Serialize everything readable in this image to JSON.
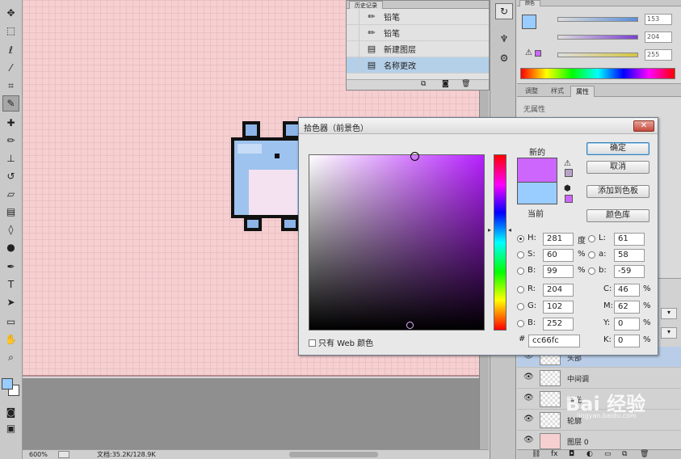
{
  "toolbox": {
    "tools": [
      {
        "name": "move-tool-icon",
        "glyph": "✥"
      },
      {
        "name": "marquee-tool-icon",
        "glyph": "⬚"
      },
      {
        "name": "lasso-tool-icon",
        "glyph": "ℓ"
      },
      {
        "name": "magic-wand-tool-icon",
        "glyph": "⁄"
      },
      {
        "name": "crop-tool-icon",
        "glyph": "⌗"
      },
      {
        "name": "eyedropper-tool-icon",
        "glyph": "✎"
      },
      {
        "name": "healing-brush-tool-icon",
        "glyph": "✚"
      },
      {
        "name": "brush-tool-icon",
        "glyph": "✏"
      },
      {
        "name": "clone-stamp-tool-icon",
        "glyph": "⊥"
      },
      {
        "name": "history-brush-tool-icon",
        "glyph": "↺"
      },
      {
        "name": "eraser-tool-icon",
        "glyph": "▱"
      },
      {
        "name": "gradient-tool-icon",
        "glyph": "▤"
      },
      {
        "name": "blur-tool-icon",
        "glyph": "◊"
      },
      {
        "name": "dodge-tool-icon",
        "glyph": "●"
      },
      {
        "name": "pen-tool-icon",
        "glyph": "✒"
      },
      {
        "name": "type-tool-icon",
        "glyph": "T"
      },
      {
        "name": "path-selection-tool-icon",
        "glyph": "➤"
      },
      {
        "name": "shape-tool-icon",
        "glyph": "▭"
      },
      {
        "name": "hand-tool-icon",
        "glyph": "✋"
      },
      {
        "name": "zoom-tool-icon",
        "glyph": "⌕"
      }
    ],
    "active_index": 5
  },
  "history": {
    "tab_label": "历史记录",
    "items": [
      {
        "label": "铅笔",
        "icon": "pencil-icon",
        "glyph": "✏"
      },
      {
        "label": "铅笔",
        "icon": "pencil-icon",
        "glyph": "✏"
      },
      {
        "label": "新建图层",
        "icon": "document-icon",
        "glyph": "▤"
      },
      {
        "label": "名称更改",
        "icon": "document-icon",
        "glyph": "▤"
      }
    ],
    "selected_index": 3,
    "footer": {
      "new_doc": "⧉",
      "snapshot": "◙",
      "trash": "🗑"
    }
  },
  "status": {
    "zoom": "600%",
    "doc_size": "文档:35.2K/128.9K"
  },
  "color_panel": {
    "tab_label": "颜色",
    "sliders": [
      {
        "value": "153",
        "color": "#5a8ed8"
      },
      {
        "value": "204",
        "color": "#7a3fd0"
      },
      {
        "value": "255",
        "color": "#d6c640"
      }
    ]
  },
  "props_panel": {
    "tabs": [
      "调整",
      "样式",
      "属性"
    ],
    "active_tab": 2,
    "text": "无属性"
  },
  "layers": {
    "rows": [
      {
        "name": "头部"
      },
      {
        "name": "中间调"
      },
      {
        "name": "高光"
      },
      {
        "name": "轮廓"
      },
      {
        "name": "图层 0"
      }
    ],
    "selected_index": 0
  },
  "picker": {
    "title": "拾色器（前景色）",
    "close": "✕",
    "new_label": "新的",
    "current_label": "当前",
    "new_color": "#cc66fc",
    "current_color": "#99ccff",
    "buttons": {
      "ok": "确定",
      "cancel": "取消",
      "add_swatch": "添加到色板",
      "libraries": "颜色库"
    },
    "hsb": [
      {
        "label": "H:",
        "value": "281",
        "unit": "度",
        "selected": true
      },
      {
        "label": "S:",
        "value": "60",
        "unit": "%",
        "selected": false
      },
      {
        "label": "B:",
        "value": "99",
        "unit": "%",
        "selected": false
      }
    ],
    "rgb": [
      {
        "label": "R:",
        "value": "204"
      },
      {
        "label": "G:",
        "value": "102"
      },
      {
        "label": "B:",
        "value": "252"
      }
    ],
    "lab": [
      {
        "label": "L:",
        "value": "61"
      },
      {
        "label": "a:",
        "value": "58"
      },
      {
        "label": "b:",
        "value": "-59"
      }
    ],
    "cmyk": [
      {
        "label": "C:",
        "value": "46",
        "unit": "%"
      },
      {
        "label": "M:",
        "value": "62",
        "unit": "%"
      },
      {
        "label": "Y:",
        "value": "0",
        "unit": "%"
      },
      {
        "label": "K:",
        "value": "0",
        "unit": "%"
      }
    ],
    "web_only_label": "只有 Web 颜色",
    "hex_prefix": "#",
    "hex": "cc66fc"
  },
  "watermark": {
    "text": "Bai 经验",
    "sub": "jingyan.baidu.com"
  }
}
